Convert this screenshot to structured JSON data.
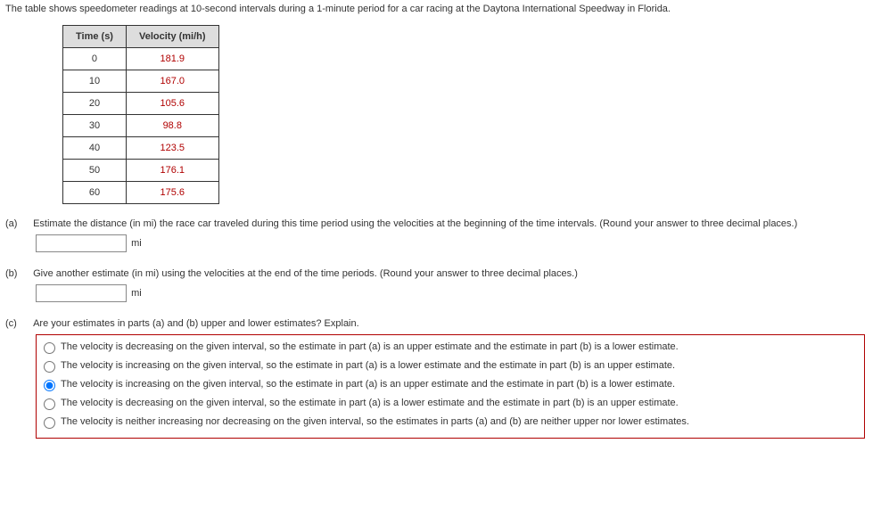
{
  "intro": "The table shows speedometer readings at 10-second intervals during a 1-minute period for a car racing at the Daytona International Speedway in Florida.",
  "table": {
    "headers": [
      "Time (s)",
      "Velocity (mi/h)"
    ],
    "rows": [
      {
        "time": "0",
        "velocity": "181.9"
      },
      {
        "time": "10",
        "velocity": "167.0"
      },
      {
        "time": "20",
        "velocity": "105.6"
      },
      {
        "time": "30",
        "velocity": "98.8"
      },
      {
        "time": "40",
        "velocity": "123.5"
      },
      {
        "time": "50",
        "velocity": "176.1"
      },
      {
        "time": "60",
        "velocity": "175.6"
      }
    ]
  },
  "part_a": {
    "label": "(a)",
    "text": "Estimate the distance (in mi) the race car traveled during this time period using the velocities at the beginning of the time intervals. (Round your answer to three decimal places.)",
    "unit": "mi",
    "value": ""
  },
  "part_b": {
    "label": "(b)",
    "text": "Give another estimate (in mi) using the velocities at the end of the time periods. (Round your answer to three decimal places.)",
    "unit": "mi",
    "value": ""
  },
  "part_c": {
    "label": "(c)",
    "text": "Are your estimates in parts (a) and (b) upper and lower estimates? Explain.",
    "options": [
      "The velocity is decreasing on the given interval, so the estimate in part (a) is an upper estimate and the estimate in part (b) is a lower estimate.",
      "The velocity is increasing on the given interval, so the estimate in part (a) is a lower estimate and the estimate in part (b) is an upper estimate.",
      "The velocity is increasing on the given interval, so the estimate in part (a) is an upper estimate and the estimate in part (b) is a lower estimate.",
      "The velocity is decreasing on the given interval, so the estimate in part (a) is a lower estimate and the estimate in part (b) is an upper estimate.",
      "The velocity is neither increasing nor decreasing on the given interval, so the estimates in parts (a) and (b) are neither upper nor lower estimates."
    ],
    "selected": 2
  }
}
